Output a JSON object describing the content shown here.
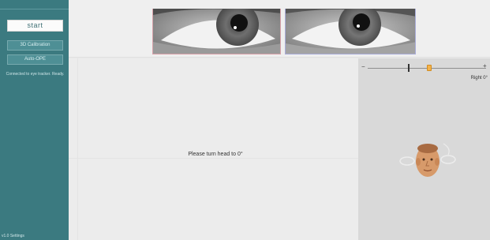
{
  "sidebar": {
    "start_label": "start",
    "buttons": [
      "3D Calibration",
      "Auto-OPE"
    ],
    "note": "Connected to eye tracker. Ready.",
    "footer": "v1.0  Settings"
  },
  "work_area": {
    "instruction": "Please turn head to 0°"
  },
  "right_panel": {
    "slider_minus": "−",
    "slider_plus": "+",
    "label": "Right 0°"
  },
  "colors": {
    "sidebar": "#3b7a80",
    "slider_knob": "#f4b24a",
    "left_camera_border": "#d9a2aa",
    "right_camera_border": "#a9acd8"
  }
}
